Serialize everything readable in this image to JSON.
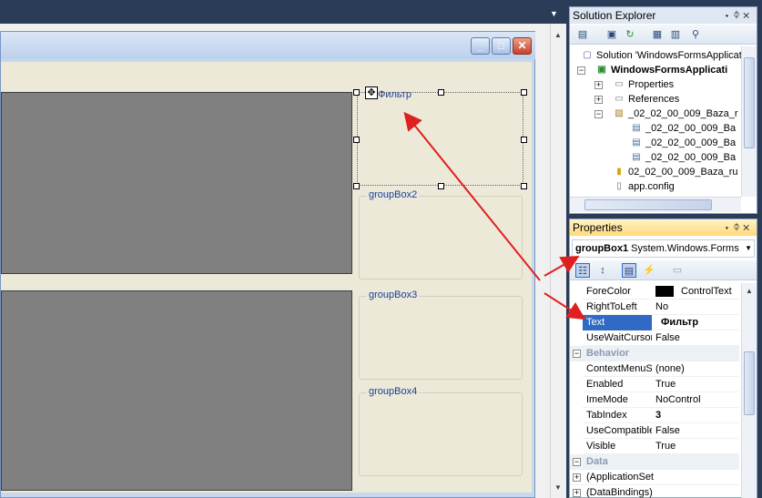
{
  "designer": {
    "groupboxes": [
      {
        "label": "Фильтр"
      },
      {
        "label": "groupBox2"
      },
      {
        "label": "groupBox3"
      },
      {
        "label": "groupBox4"
      }
    ]
  },
  "solution_explorer": {
    "title": "Solution Explorer",
    "items": [
      {
        "label": "Solution 'WindowsFormsApplicati"
      },
      {
        "label": "WindowsFormsApplicati"
      },
      {
        "label": "Properties"
      },
      {
        "label": "References"
      },
      {
        "label": "_02_02_00_009_Baza_r"
      },
      {
        "label": "_02_02_00_009_Ba"
      },
      {
        "label": "_02_02_00_009_Ba"
      },
      {
        "label": "_02_02_00_009_Ba"
      },
      {
        "label": "02_02_00_009_Baza_ru"
      },
      {
        "label": "app.config"
      }
    ]
  },
  "properties": {
    "title": "Properties",
    "object_name": "groupBox1",
    "object_type": "System.Windows.Forms",
    "rows": [
      {
        "name": "ForeColor",
        "value": "ControlText"
      },
      {
        "name": "RightToLeft",
        "value": "No"
      },
      {
        "name": "Text",
        "value": "Фильтр"
      },
      {
        "name": "UseWaitCursor",
        "value": "False"
      }
    ],
    "behavior_category": "Behavior",
    "behavior_rows": [
      {
        "name": "ContextMenuS",
        "value": "(none)"
      },
      {
        "name": "Enabled",
        "value": "True"
      },
      {
        "name": "ImeMode",
        "value": "NoControl"
      },
      {
        "name": "TabIndex",
        "value": "3"
      },
      {
        "name": "UseCompatible",
        "value": "False"
      },
      {
        "name": "Visible",
        "value": "True"
      }
    ],
    "data_category": "Data",
    "data_rows": [
      {
        "name": "(ApplicationSet"
      },
      {
        "name": "(DataBindings)"
      }
    ]
  },
  "colors": {
    "ide_background": "#2b3c59",
    "annotation_arrow": "#e02020",
    "selected_property": "#316ac5",
    "forecolor_swatch": "#000000"
  }
}
